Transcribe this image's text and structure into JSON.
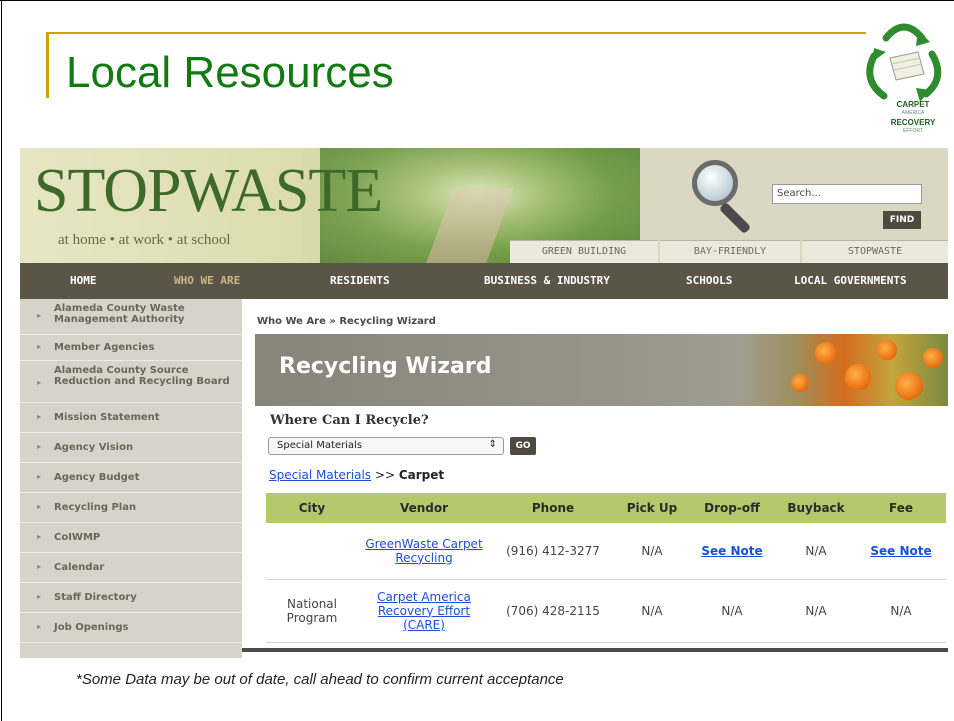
{
  "slide": {
    "title": "Local Resources",
    "footnote": "*Some Data may be out of date, call ahead to confirm current acceptance"
  },
  "logo": {
    "icon": "recycle-arrows-icon",
    "line1": "CARPET",
    "line2": "AMERICA",
    "line3": "RECOVERY",
    "line4": "EFFORT",
    "color": "#2e8b2e"
  },
  "site": {
    "brand": "STOPWASTE",
    "tagline": "at home • at work • at school",
    "search_placeholder": "Search...",
    "find_label": "FIND",
    "tabs": [
      "GREEN BUILDING",
      "BAY-FRIENDLY",
      "STOPWASTE"
    ],
    "nav": [
      "HOME",
      "WHO WE ARE",
      "RESIDENTS",
      "BUSINESS & INDUSTRY",
      "SCHOOLS",
      "LOCAL GOVERNMENTS"
    ],
    "nav_active": "WHO WE ARE",
    "nav_bg": "#5b5548"
  },
  "sidebar": {
    "items": [
      "Alameda County Waste Management Authority",
      "Member Agencies",
      "Alameda County Source Reduction and Recycling Board",
      "Mission Statement",
      "Agency Vision",
      "Agency Budget",
      "Recycling Plan",
      "CoIWMP",
      "Calendar",
      "Staff Directory",
      "Job Openings"
    ]
  },
  "main": {
    "breadcrumb": "Who We Are » Recycling Wizard",
    "header_title": "Recycling Wizard",
    "question": "Where Can I Recycle?",
    "select_value": "Special Materials",
    "go_label": "GO",
    "crumb_link": "Special Materials",
    "crumb_sep": ">>",
    "crumb_current": "Carpet",
    "table": {
      "header_color": "#b3c96b",
      "columns": [
        "City",
        "Vendor",
        "Phone",
        "Pick Up",
        "Drop-off",
        "Buyback",
        "Fee"
      ],
      "rows": [
        {
          "city": "",
          "vendor": "GreenWaste Carpet Recycling",
          "phone": "(916) 412-3277",
          "pickup": "N/A",
          "dropoff": "See Note",
          "buyback": "N/A",
          "fee": "See Note"
        },
        {
          "city": "National Program",
          "vendor": "Carpet America Recovery Effort (CARE)",
          "phone": "(706) 428-2115",
          "pickup": "N/A",
          "dropoff": "N/A",
          "buyback": "N/A",
          "fee": "N/A"
        }
      ]
    }
  }
}
